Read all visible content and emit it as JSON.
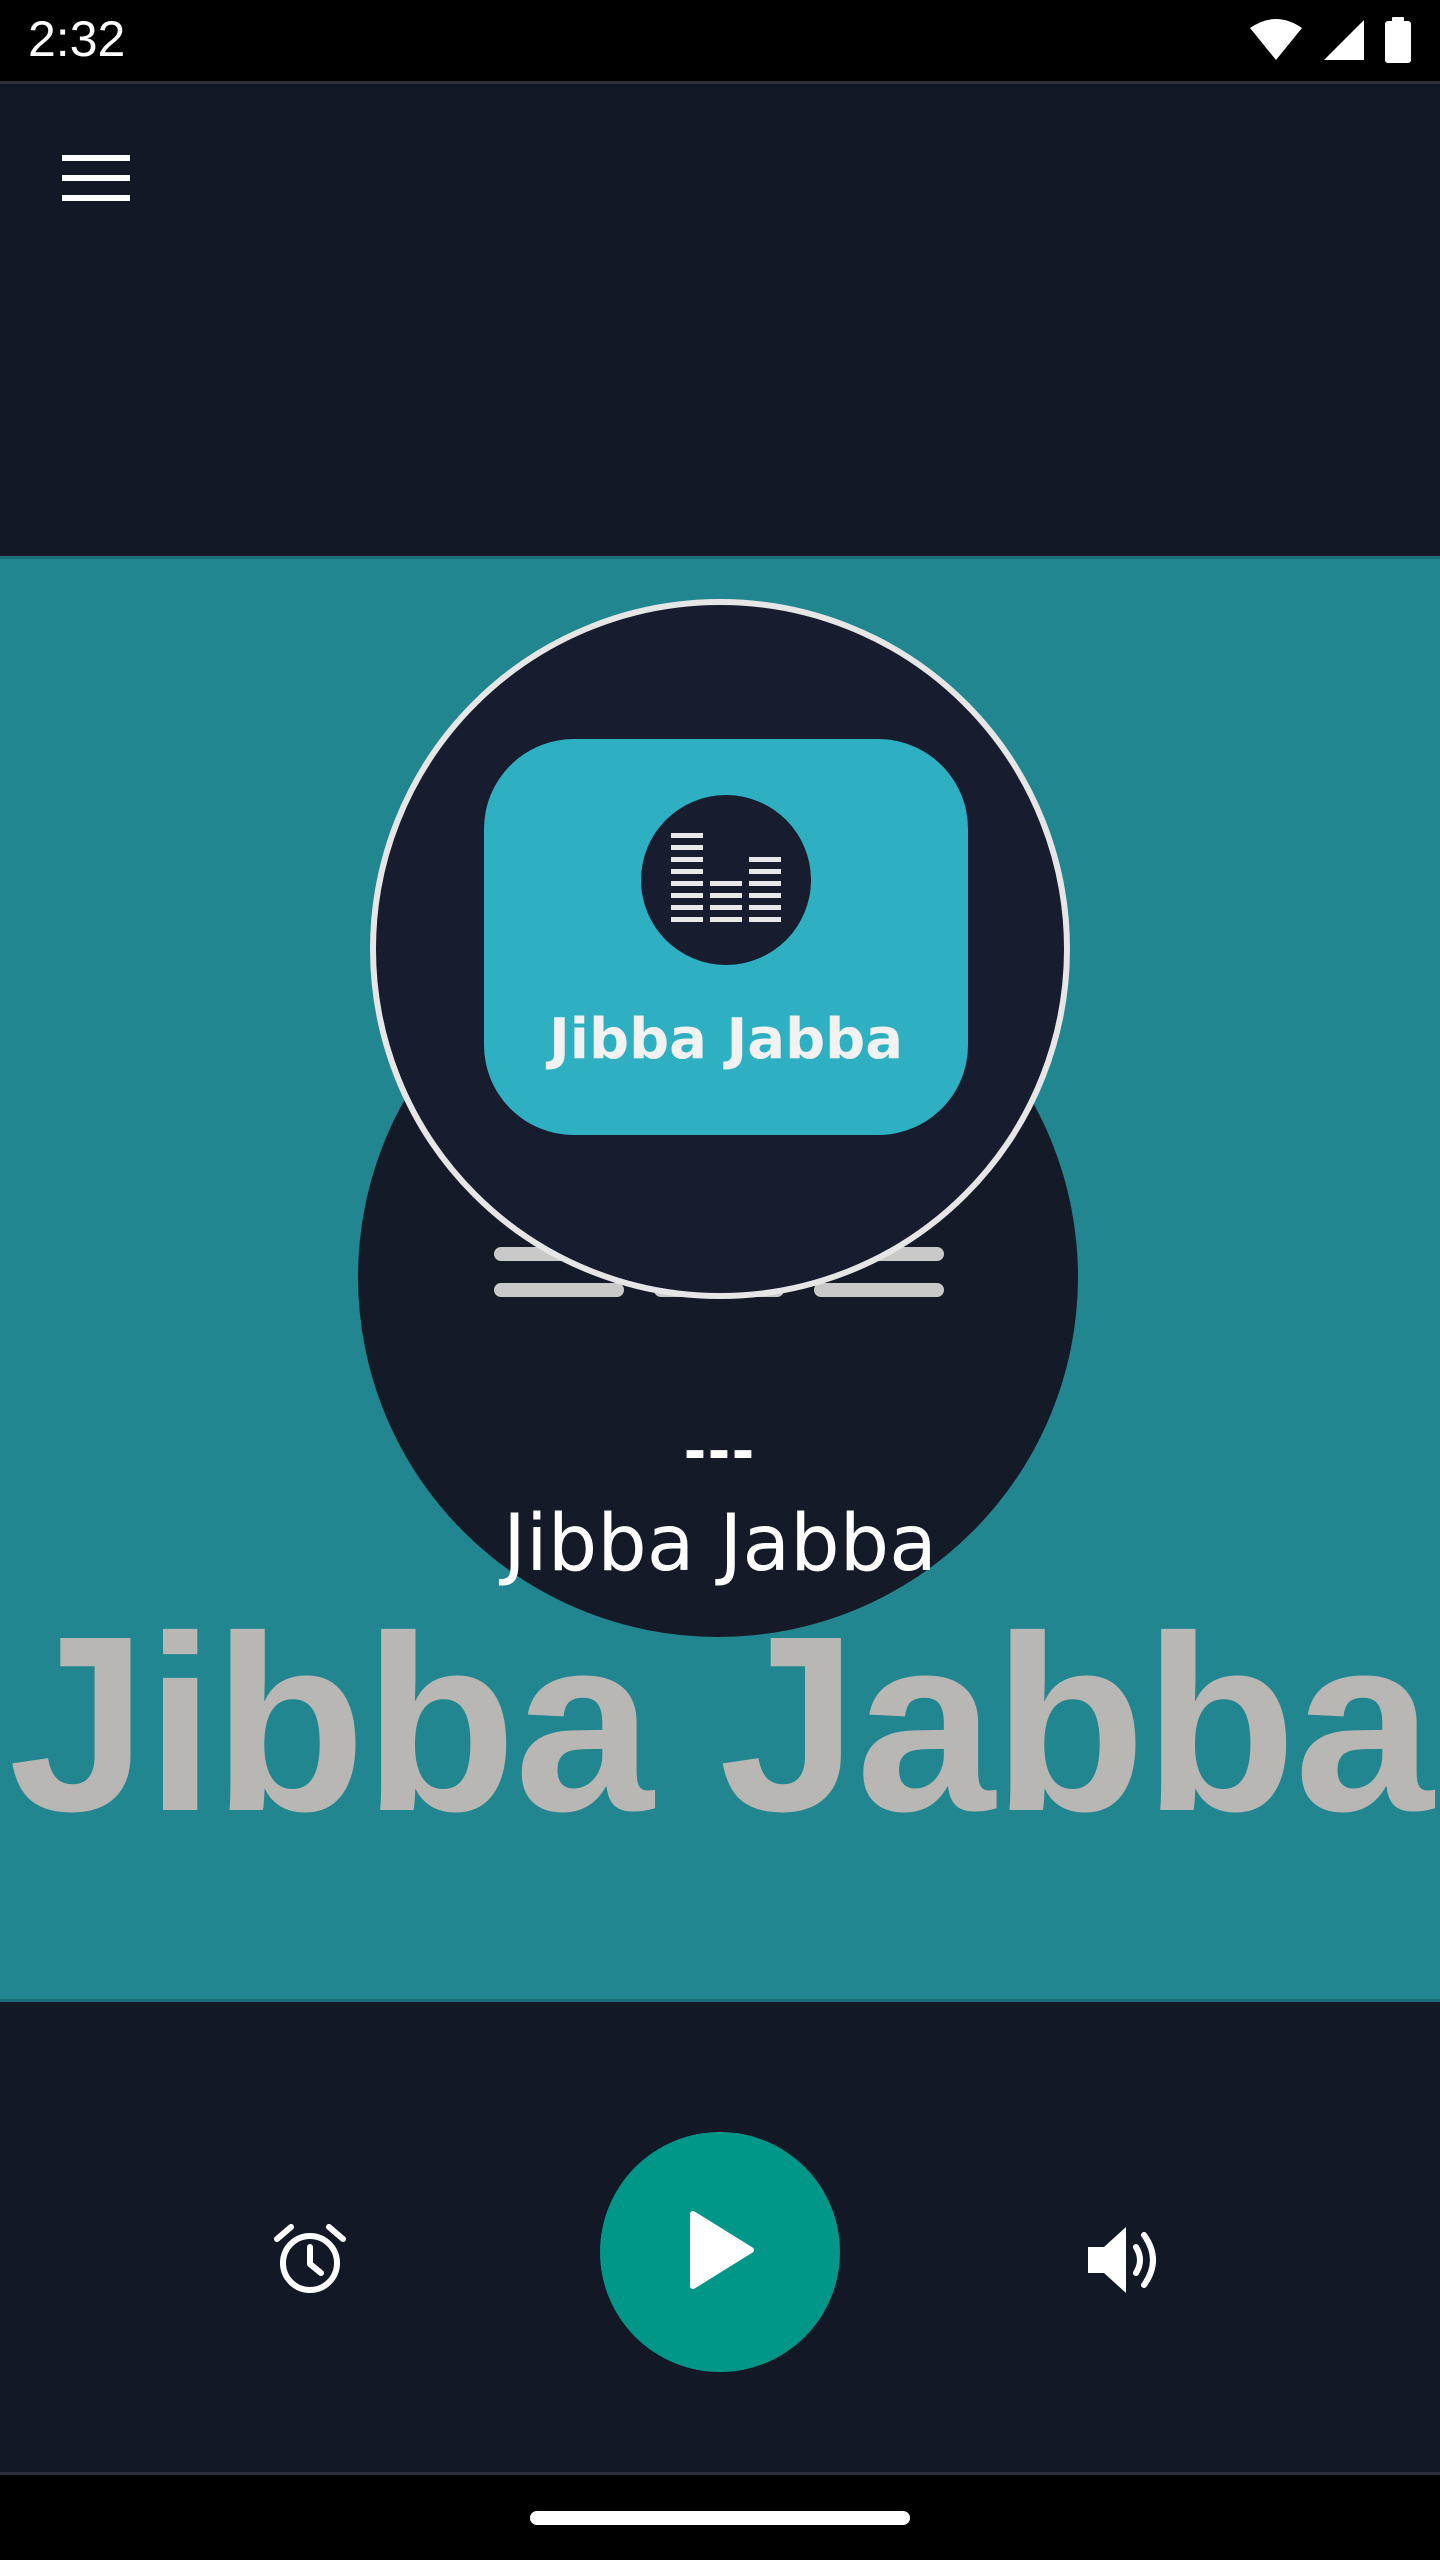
{
  "status_bar": {
    "time": "2:32",
    "icons": [
      "wifi-icon",
      "cellular-signal-icon",
      "battery-icon"
    ]
  },
  "app_bar": {
    "menu_icon": "hamburger-menu-icon"
  },
  "artwork": {
    "logo_text": "Jibba Jabba",
    "logo_icon": "equalizer-icon",
    "background_title": "Jibba Jabba",
    "colors": {
      "banner": "#218690",
      "logo_card": "#2fb0c2",
      "logo_disc": "#171c2f",
      "big_title": "#b9b7b4"
    }
  },
  "now_playing": {
    "track": "---",
    "station": "Jibba Jabba"
  },
  "controls": {
    "alarm_icon": "alarm-clock-icon",
    "play_icon": "play-icon",
    "volume_icon": "volume-icon",
    "play_color": "#009688"
  }
}
